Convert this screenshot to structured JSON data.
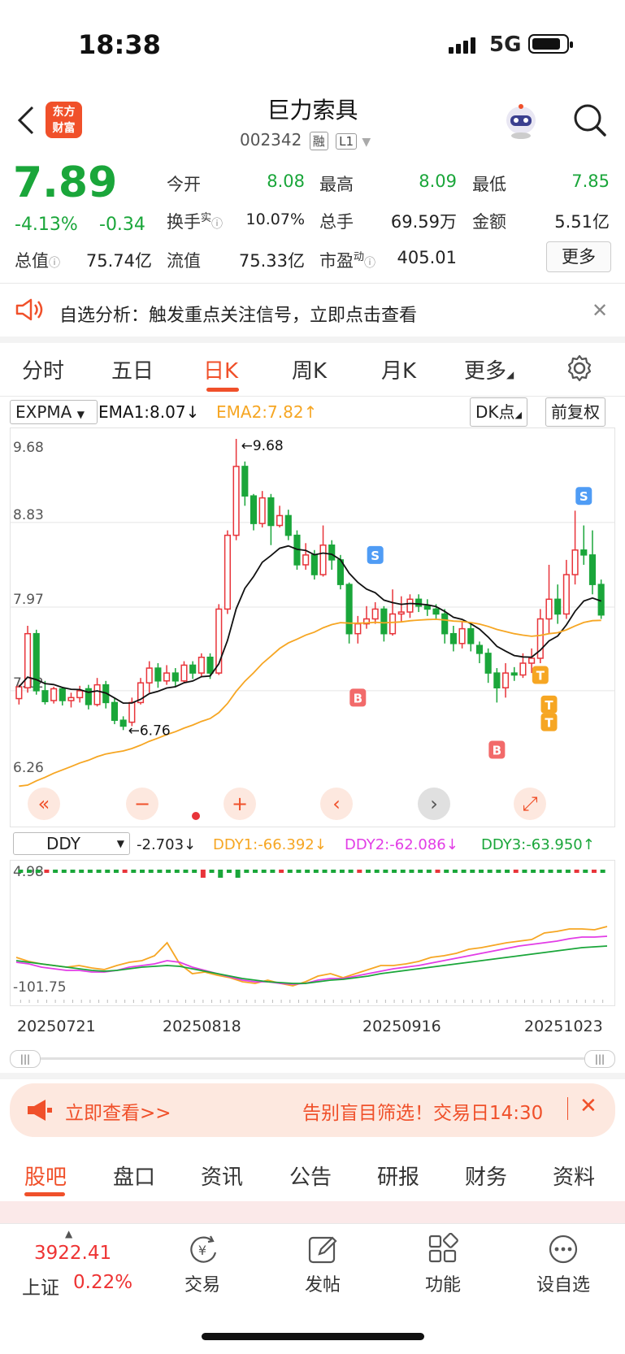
{
  "status": {
    "time": "18:38",
    "network": "5G"
  },
  "header": {
    "title": "巨力索具",
    "code": "002342",
    "tag1": "融",
    "tag2": "L1",
    "logo_line1": "东方",
    "logo_line2": "财富"
  },
  "quote": {
    "price": "7.89",
    "change_pct": "-4.13%",
    "change": "-0.34",
    "open_label": "今开",
    "open": "8.08",
    "high_label": "最高",
    "high": "8.09",
    "low_label": "最低",
    "low": "7.85",
    "turnover_label": "换手",
    "turnover_sup": "实",
    "turnover": "10.07%",
    "volume_label": "总手",
    "volume": "69.59万",
    "amount_label": "金额",
    "amount": "5.51亿",
    "mktcap_label": "总值",
    "mktcap": "75.74亿",
    "float_label": "流值",
    "float": "75.33亿",
    "pe_label": "市盈",
    "pe_sup": "动",
    "pe": "405.01",
    "more_button": "更多"
  },
  "alert": {
    "text": "自选分析：触发重点关注信号，立即点击查看"
  },
  "tabs": [
    {
      "label": "分时"
    },
    {
      "label": "五日"
    },
    {
      "label": "日K"
    },
    {
      "label": "周K"
    },
    {
      "label": "月K"
    },
    {
      "label": "更多"
    }
  ],
  "chart_toolbar": {
    "indicator": "EXPMA",
    "ema1": "EMA1:8.07",
    "ema2": "EMA2:7.82",
    "dk_button": "DK点",
    "adjust_button": "前复权"
  },
  "sub_toolbar": {
    "indicator": "DDY",
    "value": "-2.703",
    "ddy1": "DDY1:-66.392",
    "ddy2": "DDY2:-62.086",
    "ddy3": "DDY3:-63.950"
  },
  "chart_data": {
    "type": "candlestick",
    "y_ticks": [
      "9.68",
      "8.83",
      "7.97",
      "7.12",
      "6.26"
    ],
    "ylim": [
      6.26,
      9.68
    ],
    "max_label": "9.68",
    "min_label": "6.76",
    "sub_y_ticks": [
      "4.98",
      "-101.75"
    ],
    "x_labels": [
      "20250721",
      "20250818",
      "20250916",
      "20251023"
    ],
    "signals": [
      "B",
      "S",
      "B",
      "T",
      "T",
      "T",
      "S"
    ],
    "colors": {
      "up": "#e8343a",
      "down": "#1aa63a",
      "ema1": "#111111",
      "ema2": "#f6a623",
      "ddy2": "#e23de6",
      "ddy3": "#1aa63a"
    },
    "candles": [
      [
        7.04,
        7.16,
        6.98,
        7.18
      ],
      [
        7.15,
        7.7,
        7.1,
        7.78
      ],
      [
        7.7,
        7.12,
        7.08,
        7.74
      ],
      [
        7.12,
        7.01,
        6.98,
        7.22
      ],
      [
        7.02,
        7.14,
        6.99,
        7.16
      ],
      [
        7.14,
        7.02,
        6.97,
        7.16
      ],
      [
        7.02,
        7.05,
        6.95,
        7.1
      ],
      [
        7.05,
        7.12,
        7.0,
        7.17
      ],
      [
        7.14,
        6.98,
        6.93,
        7.18
      ],
      [
        6.98,
        7.18,
        6.96,
        7.25
      ],
      [
        7.18,
        7.0,
        6.94,
        7.22
      ],
      [
        7.0,
        6.82,
        6.78,
        7.04
      ],
      [
        6.82,
        6.76,
        6.72,
        6.86
      ],
      [
        6.8,
        7.0,
        6.76,
        7.05
      ],
      [
        7.0,
        7.2,
        6.98,
        7.25
      ],
      [
        7.2,
        7.35,
        7.1,
        7.42
      ],
      [
        7.35,
        7.22,
        7.15,
        7.4
      ],
      [
        7.22,
        7.3,
        7.18,
        7.38
      ],
      [
        7.3,
        7.22,
        7.16,
        7.35
      ],
      [
        7.22,
        7.38,
        7.2,
        7.42
      ],
      [
        7.38,
        7.3,
        7.24,
        7.42
      ],
      [
        7.3,
        7.46,
        7.26,
        7.5
      ],
      [
        7.46,
        7.3,
        7.24,
        7.5
      ],
      [
        7.3,
        7.95,
        7.28,
        8.0
      ],
      [
        7.95,
        8.7,
        7.9,
        8.75
      ],
      [
        8.7,
        9.4,
        8.65,
        9.68
      ],
      [
        9.4,
        9.1,
        9.0,
        9.45
      ],
      [
        9.1,
        8.82,
        8.75,
        9.12
      ],
      [
        8.82,
        9.08,
        8.78,
        9.15
      ],
      [
        9.08,
        8.8,
        8.6,
        9.12
      ],
      [
        8.8,
        8.9,
        8.78,
        9.0
      ],
      [
        8.9,
        8.7,
        8.65,
        8.96
      ],
      [
        8.7,
        8.4,
        8.35,
        8.75
      ],
      [
        8.4,
        8.5,
        8.35,
        8.62
      ],
      [
        8.5,
        8.3,
        8.25,
        8.55
      ],
      [
        8.3,
        8.6,
        8.28,
        8.8
      ],
      [
        8.6,
        8.45,
        8.35,
        8.65
      ],
      [
        8.45,
        8.2,
        8.15,
        8.5
      ],
      [
        8.2,
        7.7,
        7.6,
        8.22
      ],
      [
        7.7,
        7.8,
        7.6,
        7.88
      ],
      [
        7.8,
        7.85,
        7.75,
        7.98
      ],
      [
        7.85,
        7.95,
        7.8,
        8.02
      ],
      [
        7.95,
        7.7,
        7.62,
        7.98
      ],
      [
        7.7,
        7.9,
        7.68,
        8.15
      ],
      [
        7.9,
        7.92,
        7.82,
        8.08
      ],
      [
        7.92,
        8.05,
        7.86,
        8.1
      ],
      [
        8.05,
        7.98,
        7.92,
        8.1
      ],
      [
        7.98,
        7.95,
        7.88,
        8.05
      ],
      [
        7.95,
        7.9,
        7.85,
        8.0
      ],
      [
        7.9,
        7.7,
        7.6,
        7.95
      ],
      [
        7.7,
        7.6,
        7.52,
        7.78
      ],
      [
        7.6,
        7.75,
        7.55,
        7.82
      ],
      [
        7.75,
        7.6,
        7.52,
        7.8
      ],
      [
        7.58,
        7.5,
        7.4,
        7.62
      ],
      [
        7.5,
        7.3,
        7.2,
        7.55
      ],
      [
        7.3,
        7.15,
        7.0,
        7.35
      ],
      [
        7.15,
        7.3,
        7.05,
        7.4
      ],
      [
        7.3,
        7.28,
        7.22,
        7.36
      ],
      [
        7.28,
        7.4,
        7.25,
        7.5
      ],
      [
        7.4,
        7.45,
        7.3,
        7.55
      ],
      [
        7.45,
        7.85,
        7.4,
        7.95
      ],
      [
        7.85,
        8.05,
        7.7,
        8.4
      ],
      [
        8.05,
        7.9,
        7.8,
        8.2
      ],
      [
        7.9,
        8.3,
        7.85,
        8.45
      ],
      [
        8.3,
        8.55,
        8.2,
        8.95
      ],
      [
        8.55,
        8.5,
        8.4,
        8.8
      ],
      [
        8.5,
        8.2,
        8.1,
        8.75
      ],
      [
        8.2,
        7.89,
        7.85,
        8.25
      ]
    ]
  },
  "promo": {
    "text1": "立即查看>>",
    "text2": "告别盲目筛选！交易日14:30"
  },
  "bottom_tabs": [
    {
      "label": "股吧"
    },
    {
      "label": "盘口"
    },
    {
      "label": "资讯"
    },
    {
      "label": "公告"
    },
    {
      "label": "研报"
    },
    {
      "label": "财务"
    },
    {
      "label": "资料"
    }
  ],
  "bottom_nav": {
    "index_value": "3922.41",
    "index_name": "上证",
    "index_change": "0.22%",
    "items": [
      {
        "label": "交易"
      },
      {
        "label": "发帖"
      },
      {
        "label": "功能"
      },
      {
        "label": "设自选"
      }
    ]
  }
}
